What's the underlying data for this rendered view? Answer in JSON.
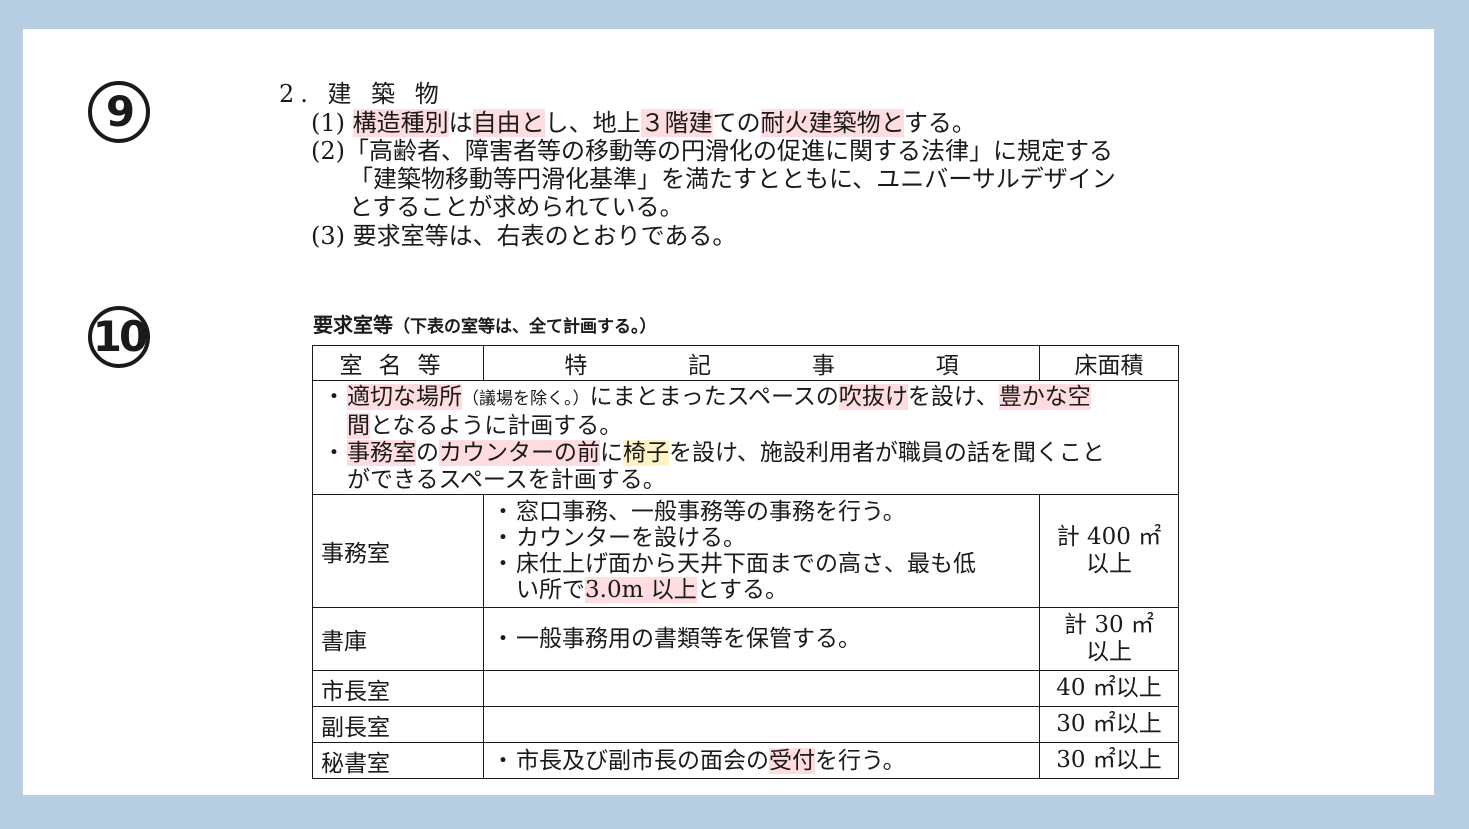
{
  "markers": {
    "nine": "⑨",
    "ten": "⑩"
  },
  "section": {
    "title": "2. 建 築 物",
    "item1": {
      "num": "(1)",
      "p1": "構造種別",
      "p2": "は",
      "p3": "自由と",
      "p4": "し、地上",
      "p5": "３階建",
      "p6": "ての",
      "p7": "耐火建築物と",
      "p8": "する。"
    },
    "item2": {
      "num": "(2)",
      "l1": "「高齢者、障害者等の移動等の円滑化の促進に関する法律」に規定する",
      "l2": "「建築物移動等円滑化基準」を満たすとともに、ユニバーサルデザイン",
      "l3": "とすることが求められている。"
    },
    "item3": {
      "num": "(3)",
      "text": "要求室等は、右表のとおりである。"
    }
  },
  "table": {
    "title": "要求室等",
    "title_note": "（下表の室等は、全て計画する。）",
    "headers": {
      "name": "室名等",
      "spec": [
        "特",
        "記",
        "事",
        "項"
      ],
      "area": "床面積"
    },
    "common": {
      "b1": {
        "p1": "適切な場所",
        "p2": "（議場を除く。）",
        "p3": "にまとまったスペースの",
        "p4": "吹抜け",
        "p5": "を設け、",
        "p6": "豊かな空",
        "p7": "間",
        "p8": "となるように計画する。"
      },
      "b2": {
        "p1": "事務室",
        "p2": "の",
        "p3": "カウンターの前",
        "p4": "に",
        "p5": "椅子",
        "p6": "を設け、施設利用者が職員の話を聞くこと",
        "p7": "ができるスペースを計画する。"
      }
    },
    "rows": [
      {
        "name": "事務室",
        "s1": "窓口事務、一般事務等の事務を行う。",
        "s2": "カウンターを設ける。",
        "s3a": "床仕上げ面から天井下面までの高さ、最も低",
        "s3b": "い所で",
        "s3c": "3.0m 以上",
        "s3d": "とする。",
        "area1": "計 400 ㎡",
        "area2": "以上"
      },
      {
        "name": "書庫",
        "s1": "一般事務用の書類等を保管する。",
        "area1": "計 30 ㎡",
        "area2": "以上"
      },
      {
        "name": "市長室",
        "area": "40 ㎡以上"
      },
      {
        "name": "副長室",
        "area": "30 ㎡以上"
      },
      {
        "name": "秘書室",
        "s1a": "市長及び副市長の面会の",
        "s1b": "受付",
        "s1c": "を行う。",
        "area": "30 ㎡以上"
      }
    ]
  }
}
